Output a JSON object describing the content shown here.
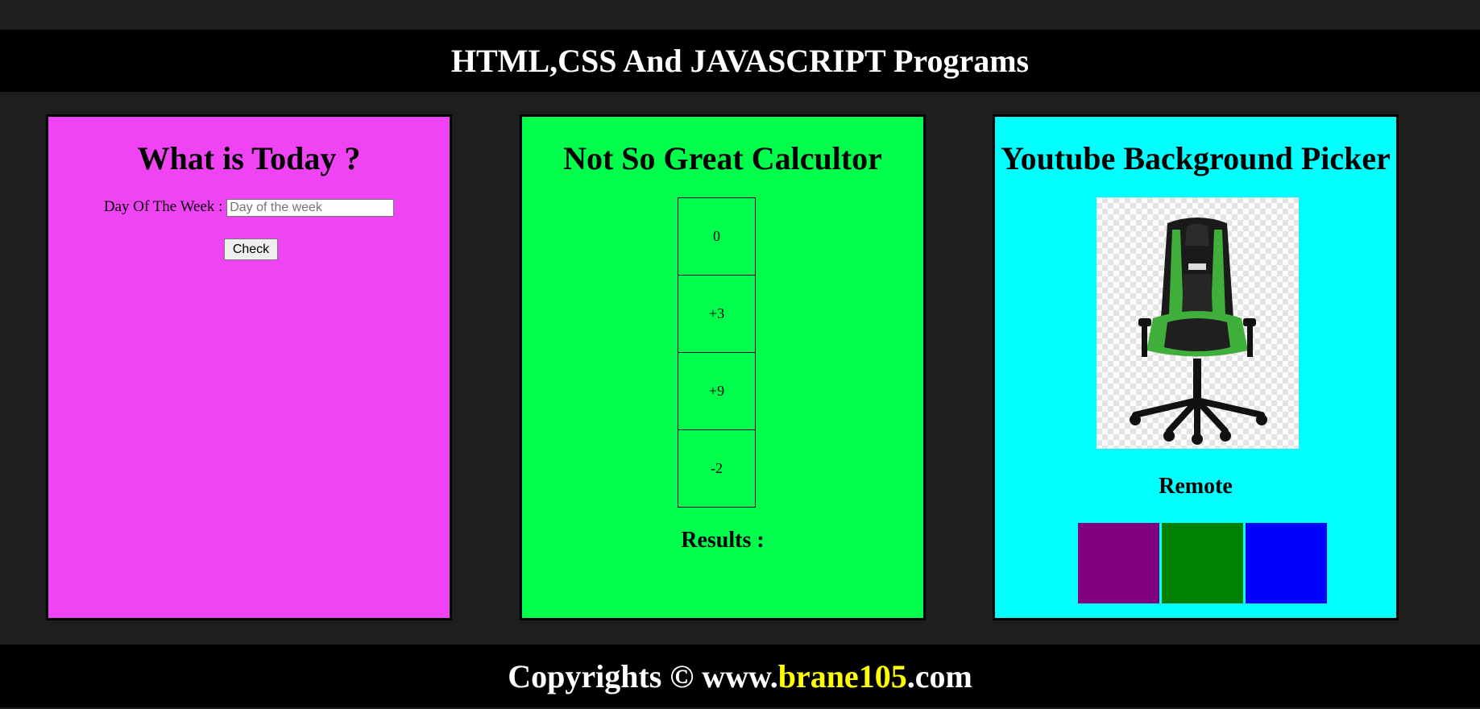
{
  "header": {
    "title": "HTML,CSS And JAVASCRIPT Programs"
  },
  "cards": {
    "today": {
      "title": "What is Today ?",
      "day_label": "Day Of The Week :",
      "day_placeholder": "Day of the week",
      "day_value": "",
      "check_label": "Check"
    },
    "calculator": {
      "title": "Not So Great Calcultor",
      "buttons": [
        "0",
        "+3",
        "+9",
        "-2"
      ],
      "results_label": "Results :"
    },
    "youtube": {
      "title": "Youtube Background Picker",
      "remote_label": "Remote",
      "swatches": [
        {
          "name": "purple",
          "color": "#800080"
        },
        {
          "name": "green",
          "color": "#008000"
        },
        {
          "name": "blue",
          "color": "#0000ff"
        }
      ]
    }
  },
  "footer": {
    "prefix": "Copyrights © www.",
    "brand": "brane105",
    "suffix": ".com",
    "brand_color": "#ffff00"
  },
  "colors": {
    "background": "#1f1e1f",
    "card_today": "#f044f4",
    "card_calculator": "#00ff4c",
    "card_youtube": "#00ffff"
  }
}
